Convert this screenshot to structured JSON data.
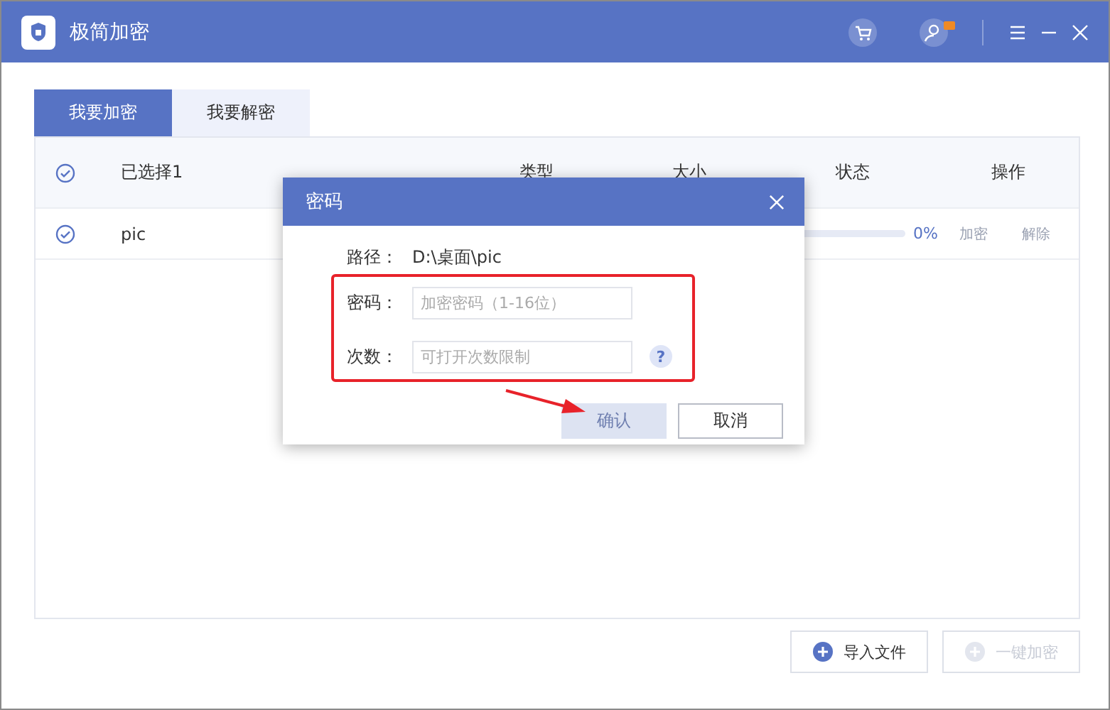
{
  "window": {
    "title": "极简加密"
  },
  "tabs": [
    {
      "label": "我要加密",
      "selected": true
    },
    {
      "label": "我要解密",
      "selected": false
    }
  ],
  "table": {
    "all_checked": true,
    "columns": [
      "已选择1",
      "类型",
      "大小",
      "状态",
      "操作"
    ],
    "rows": [
      {
        "name": "pic",
        "checked": true,
        "level": 0,
        "percent": "0%",
        "actions": [
          {
            "label": "加密",
            "disabled": true
          },
          {
            "label": "解除",
            "disabled": true
          }
        ]
      }
    ]
  },
  "footer_buttons": [
    {
      "label": "导入文件",
      "disabled": false
    },
    {
      "label": "一键加密",
      "disabled": true
    }
  ],
  "dialog": {
    "title": "密码",
    "path_label": "路径：",
    "path": "D:\\桌面\\pic",
    "fields": [
      {
        "label": "密码：",
        "placeholder": "加密密码（1-16位）",
        "help": false
      },
      {
        "label": "次数：",
        "placeholder": "可打开次数限制",
        "help": true
      }
    ],
    "help_mark": "?",
    "confirm": {
      "label": "确认",
      "disabled": true
    },
    "cancel": {
      "label": "取消"
    }
  }
}
